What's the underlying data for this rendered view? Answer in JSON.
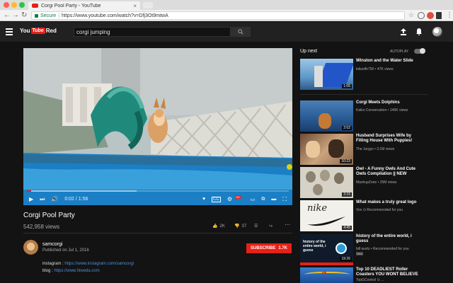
{
  "browser": {
    "tab_title": "Corgi Pool Party - YouTube",
    "tab_close": "×",
    "secure_label": "Secure",
    "url_separator": "|",
    "url": "https://www.youtube.com/watch?v=Dfj3Ot9mtwA"
  },
  "header": {
    "logo_you": "You",
    "logo_tube": "Tube",
    "logo_red": "Red",
    "search_value": "corgi jumping"
  },
  "player": {
    "time": "0:02 / 1:56",
    "progress": 0.017,
    "loaded": 0.42
  },
  "video": {
    "title": "Corgi Pool Party",
    "views": "542,958 views",
    "likes": "2K",
    "dislikes": "37"
  },
  "channel": {
    "name": "samcorgi",
    "published": "Published on Jul 1, 2016",
    "subscribe_label": "SUBSCRIBE",
    "subscriber_count": "1.7K",
    "desc_instagram_label": "instagram : ",
    "desc_instagram_link": "https://www.instagram.com/samcorgi",
    "desc_blog_label": "blog : ",
    "desc_blog_link": "https://www.hiweda.com"
  },
  "sidebar": {
    "up_next": "Up next",
    "autoplay": "AUTOPLAY",
    "items": [
      {
        "title": "Winston and the Water Slide",
        "meta": "kdwolfe750 • 47K views",
        "duration": "1:05"
      },
      {
        "title": "Corgi Meets Dolphins",
        "meta": "Kaiko Conservation • 146K views",
        "duration": "2:02"
      },
      {
        "title": "Husband Surprises Wife by Filling House With Puppies!",
        "meta": "The Jurgys • 3.1M views",
        "duration": "10:23"
      },
      {
        "title": "Owl - A Funny Owls And Cute Owls Compilation || NEW",
        "meta": "MashupZone • 25M views",
        "duration": "3:16"
      },
      {
        "title": "What makes a truly great logo",
        "meta": "Vox ⊙ Recommended for you",
        "duration": "4:45",
        "thumb_text": "nike"
      },
      {
        "title": "history of the entire world, i guess",
        "meta": "bill wurtz • Recommended for you",
        "duration": "19:26",
        "badge": "New",
        "thumb_text": "history of the entire world, i guess"
      },
      {
        "title": "Top 10 DEADLIEST Roller Coasters YOU WONT BELIEVE",
        "meta": "TopGControl ⊙ ..."
      }
    ]
  }
}
